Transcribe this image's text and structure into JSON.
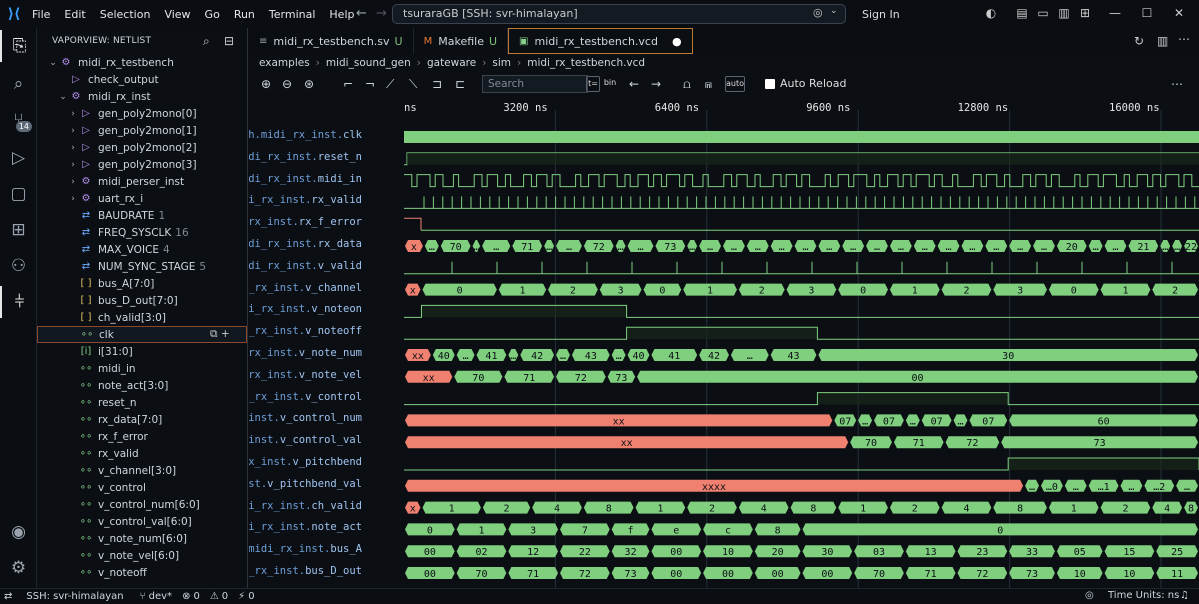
{
  "menu": [
    "File",
    "Edit",
    "Selection",
    "View",
    "Go",
    "Run",
    "Terminal",
    "Help"
  ],
  "command_center": "tsuraraGB [SSH: svr-himalayan]",
  "sign_in": "Sign In",
  "sidebar": {
    "title": "VAPORVIEW: NETLIST",
    "items": [
      {
        "twisty": "v",
        "icon": "module",
        "label": "midi_rx_testbench",
        "value": "",
        "depth": 0
      },
      {
        "twisty": "",
        "icon": "process",
        "label": "check_output",
        "value": "",
        "depth": 1
      },
      {
        "twisty": "v",
        "icon": "module",
        "label": "midi_rx_inst",
        "value": "",
        "depth": 1
      },
      {
        "twisty": ">",
        "icon": "process",
        "label": "gen_poly2mono[0]",
        "value": "",
        "depth": 2
      },
      {
        "twisty": ">",
        "icon": "process",
        "label": "gen_poly2mono[1]",
        "value": "",
        "depth": 2
      },
      {
        "twisty": ">",
        "icon": "process",
        "label": "gen_poly2mono[2]",
        "value": "",
        "depth": 2
      },
      {
        "twisty": ">",
        "icon": "process",
        "label": "gen_poly2mono[3]",
        "value": "",
        "depth": 2
      },
      {
        "twisty": ">",
        "icon": "module",
        "label": "midi_perser_inst",
        "value": "",
        "depth": 2
      },
      {
        "twisty": ">",
        "icon": "module",
        "label": "uart_rx_i",
        "value": "",
        "depth": 2
      },
      {
        "twisty": "",
        "icon": "param",
        "label": "BAUDRATE",
        "value": "1",
        "depth": 2
      },
      {
        "twisty": "",
        "icon": "param",
        "label": "FREQ_SYSCLK",
        "value": "16",
        "depth": 2
      },
      {
        "twisty": "",
        "icon": "param",
        "label": "MAX_VOICE",
        "value": "4",
        "depth": 2
      },
      {
        "twisty": "",
        "icon": "param",
        "label": "NUM_SYNC_STAGE",
        "value": "5",
        "depth": 2
      },
      {
        "twisty": "",
        "icon": "bus",
        "label": "bus_A[7:0]",
        "value": "",
        "depth": 2
      },
      {
        "twisty": "",
        "icon": "bus",
        "label": "bus_D_out[7:0]",
        "value": "",
        "depth": 2
      },
      {
        "twisty": "",
        "icon": "bus",
        "label": "ch_valid[3:0]",
        "value": "",
        "depth": 2
      },
      {
        "twisty": "",
        "icon": "signal",
        "label": "clk",
        "value": "",
        "depth": 2,
        "selected": true
      },
      {
        "twisty": "",
        "icon": "int",
        "label": "i[31:0]",
        "value": "",
        "depth": 2
      },
      {
        "twisty": "",
        "icon": "signal",
        "label": "midi_in",
        "value": "",
        "depth": 2
      },
      {
        "twisty": "",
        "icon": "signal",
        "label": "note_act[3:0]",
        "value": "",
        "depth": 2
      },
      {
        "twisty": "",
        "icon": "signal",
        "label": "reset_n",
        "value": "",
        "depth": 2
      },
      {
        "twisty": "",
        "icon": "signal",
        "label": "rx_data[7:0]",
        "value": "",
        "depth": 2
      },
      {
        "twisty": "",
        "icon": "signal",
        "label": "rx_f_error",
        "value": "",
        "depth": 2
      },
      {
        "twisty": "",
        "icon": "signal",
        "label": "rx_valid",
        "value": "",
        "depth": 2
      },
      {
        "twisty": "",
        "icon": "signal",
        "label": "v_channel[3:0]",
        "value": "",
        "depth": 2
      },
      {
        "twisty": "",
        "icon": "signal",
        "label": "v_control",
        "value": "",
        "depth": 2
      },
      {
        "twisty": "",
        "icon": "signal",
        "label": "v_control_num[6:0]",
        "value": "",
        "depth": 2
      },
      {
        "twisty": "",
        "icon": "signal",
        "label": "v_control_val[6:0]",
        "value": "",
        "depth": 2
      },
      {
        "twisty": "",
        "icon": "signal",
        "label": "v_note_num[6:0]",
        "value": "",
        "depth": 2
      },
      {
        "twisty": "",
        "icon": "signal",
        "label": "v_note_vel[6:0]",
        "value": "",
        "depth": 2
      },
      {
        "twisty": "",
        "icon": "signal",
        "label": "v_noteoff",
        "value": "",
        "depth": 2
      }
    ]
  },
  "tabs": [
    {
      "label": "midi_rx_testbench.sv",
      "status": "U",
      "icon": "≡",
      "icon_color": "#9aa3ad",
      "active": false
    },
    {
      "label": "Makefile",
      "status": "U",
      "icon": "M",
      "icon_color": "#e37933",
      "active": false
    },
    {
      "label": "midi_rx_testbench.vcd",
      "status": "●",
      "icon": "▣",
      "icon_color": "#86d08a",
      "active": true
    }
  ],
  "breadcrumb": [
    "examples",
    "midi_sound_gen",
    "gateware",
    "sim",
    "midi_rx_testbench.vcd"
  ],
  "toolbar": {
    "search_placeholder": "Search",
    "regex_label": "t=",
    "bin_label": "bin",
    "auto_label": "auto",
    "auto_reload_label": "Auto Reload"
  },
  "time_axis": [
    {
      "label": "ns",
      "t": 0
    },
    {
      "label": "3200 ns",
      "t": 3200
    },
    {
      "label": "6400 ns",
      "t": 6400
    },
    {
      "label": "9600 ns",
      "t": 9600
    },
    {
      "label": "12800 ns",
      "t": 12800
    },
    {
      "label": "16000 ns",
      "t": 16000
    }
  ],
  "signals": [
    {
      "prefix": "ch.midi_rx_inst.",
      "leaf": "clk",
      "kind": "clk"
    },
    {
      "prefix": "idi_rx_inst.",
      "leaf": "reset_n",
      "kind": "bit",
      "trans": [
        [
          0,
          0
        ],
        [
          0.005,
          1
        ]
      ]
    },
    {
      "prefix": "idi_rx_inst.",
      "leaf": "midi_in",
      "kind": "serial"
    },
    {
      "prefix": "di_rx_inst.",
      "leaf": "rx_valid",
      "kind": "pulses"
    },
    {
      "prefix": "_rx_inst.",
      "leaf": "rx_f_error",
      "kind": "xbit"
    },
    {
      "prefix": "idi_rx_inst.",
      "leaf": "rx_data",
      "kind": "bus",
      "segs": [
        [
          0,
          0.025,
          "x",
          "",
          1
        ],
        [
          0.025,
          0.045,
          "…"
        ],
        [
          0.045,
          0.085,
          "70"
        ],
        [
          0.085,
          0.097,
          "…"
        ],
        [
          0.097,
          0.135,
          "…"
        ],
        [
          0.135,
          0.175,
          "71"
        ],
        [
          0.175,
          0.19,
          "…"
        ],
        [
          0.19,
          0.225,
          "…"
        ],
        [
          0.225,
          0.265,
          "72"
        ],
        [
          0.265,
          0.28,
          "…"
        ],
        [
          0.28,
          0.315,
          "…"
        ],
        [
          0.315,
          0.355,
          "73"
        ],
        [
          0.355,
          0.37,
          "…"
        ],
        [
          0.37,
          0.4,
          "…"
        ],
        [
          0.4,
          0.43,
          "…"
        ],
        [
          0.43,
          0.46,
          "…"
        ],
        [
          0.46,
          0.49,
          "…"
        ],
        [
          0.49,
          0.52,
          "…"
        ],
        [
          0.52,
          0.55,
          "…"
        ],
        [
          0.55,
          0.58,
          "…"
        ],
        [
          0.58,
          0.61,
          "…"
        ],
        [
          0.61,
          0.64,
          "…"
        ],
        [
          0.64,
          0.67,
          "…"
        ],
        [
          0.67,
          0.7,
          "…"
        ],
        [
          0.7,
          0.73,
          "…"
        ],
        [
          0.73,
          0.76,
          "…"
        ],
        [
          0.76,
          0.79,
          "…"
        ],
        [
          0.79,
          0.82,
          "…"
        ],
        [
          0.82,
          0.86,
          "20"
        ],
        [
          0.86,
          0.88,
          "…"
        ],
        [
          0.88,
          0.91,
          "…"
        ],
        [
          0.91,
          0.95,
          "21"
        ],
        [
          0.95,
          0.965,
          "…"
        ],
        [
          0.965,
          0.98,
          "…"
        ],
        [
          0.98,
          1.0,
          "22"
        ]
      ]
    },
    {
      "prefix": "idi_rx_inst.",
      "leaf": "v_valid",
      "kind": "pulses2"
    },
    {
      "prefix": "i_rx_inst.",
      "leaf": "v_channel",
      "kind": "bus",
      "segs": [
        [
          0,
          0.022,
          "x",
          "",
          1
        ],
        [
          0.022,
          0.118,
          "0"
        ],
        [
          0.118,
          0.18,
          "1"
        ],
        [
          0.18,
          0.245,
          "2"
        ],
        [
          0.245,
          0.3,
          "3"
        ],
        [
          0.3,
          0.35,
          "0"
        ],
        [
          0.35,
          0.42,
          "1"
        ],
        [
          0.42,
          0.48,
          "2"
        ],
        [
          0.48,
          0.545,
          "3"
        ],
        [
          0.545,
          0.61,
          "0"
        ],
        [
          0.61,
          0.675,
          "1"
        ],
        [
          0.675,
          0.74,
          "2"
        ],
        [
          0.74,
          0.81,
          "3"
        ],
        [
          0.81,
          0.875,
          "0"
        ],
        [
          0.875,
          0.94,
          "1"
        ],
        [
          0.94,
          1.0,
          "2"
        ]
      ]
    },
    {
      "prefix": "di_rx_inst.",
      "leaf": "v_noteon",
      "kind": "window",
      "ranges": [
        [
          0.022,
          0.28
        ]
      ]
    },
    {
      "prefix": "i_rx_inst.",
      "leaf": "v_noteoff",
      "kind": "window",
      "ranges": [
        [
          0.28,
          0.52
        ]
      ]
    },
    {
      "prefix": "_rx_inst.",
      "leaf": "v_note_num",
      "kind": "bus",
      "segs": [
        [
          0,
          0.035,
          "xx",
          "",
          1
        ],
        [
          0.035,
          0.065,
          "40"
        ],
        [
          0.065,
          0.09,
          "…"
        ],
        [
          0.09,
          0.13,
          "41"
        ],
        [
          0.13,
          0.145,
          "…"
        ],
        [
          0.145,
          0.19,
          "42"
        ],
        [
          0.19,
          0.21,
          "…"
        ],
        [
          0.21,
          0.26,
          "43"
        ],
        [
          0.26,
          0.28,
          "…"
        ],
        [
          0.28,
          0.31,
          "40"
        ],
        [
          0.31,
          0.37,
          "41"
        ],
        [
          0.37,
          0.41,
          "42"
        ],
        [
          0.41,
          0.46,
          "…"
        ],
        [
          0.46,
          0.52,
          "43"
        ],
        [
          0.52,
          1.0,
          "30"
        ]
      ]
    },
    {
      "prefix": "_rx_inst.",
      "leaf": "v_note_vel",
      "kind": "bus",
      "segs": [
        [
          0,
          0.062,
          "xx",
          "",
          1
        ],
        [
          0.062,
          0.125,
          "70"
        ],
        [
          0.125,
          0.19,
          "71"
        ],
        [
          0.19,
          0.255,
          "72"
        ],
        [
          0.255,
          0.292,
          "73"
        ],
        [
          0.292,
          1.0,
          "00"
        ]
      ]
    },
    {
      "prefix": "i_rx_inst.",
      "leaf": "v_control",
      "kind": "window",
      "ranges": [
        [
          0.52,
          0.76
        ]
      ]
    },
    {
      "prefix": "_inst.",
      "leaf": "v_control_num",
      "kind": "bus",
      "segs": [
        [
          0,
          0.54,
          "xx",
          "",
          1
        ],
        [
          0.54,
          0.57,
          "07"
        ],
        [
          0.57,
          0.59,
          "…"
        ],
        [
          0.59,
          0.63,
          "07"
        ],
        [
          0.63,
          0.65,
          "…"
        ],
        [
          0.65,
          0.69,
          "07"
        ],
        [
          0.69,
          0.71,
          "…"
        ],
        [
          0.71,
          0.76,
          "07"
        ],
        [
          0.76,
          1.0,
          "60"
        ]
      ]
    },
    {
      "prefix": "_inst.",
      "leaf": "v_control_val",
      "kind": "bus",
      "segs": [
        [
          0,
          0.56,
          "xx",
          "",
          1
        ],
        [
          0.56,
          0.615,
          "70"
        ],
        [
          0.615,
          0.68,
          "71"
        ],
        [
          0.68,
          0.75,
          "72"
        ],
        [
          0.75,
          1.0,
          "73"
        ]
      ]
    },
    {
      "prefix": "rx_inst.",
      "leaf": "v_pitchbend",
      "kind": "window",
      "ranges": [
        [
          0.76,
          1.0
        ]
      ]
    },
    {
      "prefix": "nst.",
      "leaf": "v_pitchbend_val",
      "kind": "bus",
      "segs": [
        [
          0,
          0.78,
          "xxxx",
          "",
          1
        ],
        [
          0.78,
          0.8,
          "…"
        ],
        [
          0.8,
          0.83,
          "…0"
        ],
        [
          0.83,
          0.86,
          "…"
        ],
        [
          0.86,
          0.9,
          "…1"
        ],
        [
          0.9,
          0.93,
          "…"
        ],
        [
          0.93,
          0.97,
          "…2"
        ],
        [
          0.97,
          1.0,
          "…"
        ]
      ]
    },
    {
      "prefix": "di_rx_inst.",
      "leaf": "ch_valid",
      "kind": "bus",
      "segs": [
        [
          0,
          0.022,
          "x",
          "",
          1
        ],
        [
          0.022,
          0.098,
          "1"
        ],
        [
          0.098,
          0.16,
          "2"
        ],
        [
          0.16,
          0.225,
          "4"
        ],
        [
          0.225,
          0.29,
          "8"
        ],
        [
          0.29,
          0.355,
          "1"
        ],
        [
          0.355,
          0.42,
          "2"
        ],
        [
          0.42,
          0.485,
          "4"
        ],
        [
          0.485,
          0.545,
          "8"
        ],
        [
          0.545,
          0.61,
          "1"
        ],
        [
          0.61,
          0.675,
          "2"
        ],
        [
          0.675,
          0.74,
          "4"
        ],
        [
          0.74,
          0.81,
          "8"
        ],
        [
          0.81,
          0.875,
          "1"
        ],
        [
          0.875,
          0.94,
          "2"
        ],
        [
          0.94,
          0.98,
          "4"
        ],
        [
          0.98,
          1.0,
          "8"
        ]
      ]
    },
    {
      "prefix": "di_rx_inst.",
      "leaf": "note_act",
      "kind": "bus",
      "segs": [
        [
          0,
          0.065,
          "0"
        ],
        [
          0.065,
          0.13,
          "1"
        ],
        [
          0.13,
          0.195,
          "3"
        ],
        [
          0.195,
          0.26,
          "7"
        ],
        [
          0.26,
          0.31,
          "f"
        ],
        [
          0.31,
          0.375,
          "e"
        ],
        [
          0.375,
          0.44,
          "c"
        ],
        [
          0.44,
          0.5,
          "8"
        ],
        [
          0.5,
          1.0,
          "0"
        ]
      ]
    },
    {
      "prefix": ".midi_rx_inst.",
      "leaf": "bus_A",
      "kind": "bus",
      "segs": [
        [
          0,
          0.065,
          "00"
        ],
        [
          0.065,
          0.13,
          "02"
        ],
        [
          0.13,
          0.195,
          "12"
        ],
        [
          0.195,
          0.26,
          "22"
        ],
        [
          0.26,
          0.31,
          "32"
        ],
        [
          0.31,
          0.375,
          "00"
        ],
        [
          0.375,
          0.44,
          "10"
        ],
        [
          0.44,
          0.5,
          "20"
        ],
        [
          0.5,
          0.565,
          "30"
        ],
        [
          0.565,
          0.63,
          "03"
        ],
        [
          0.63,
          0.695,
          "13"
        ],
        [
          0.695,
          0.76,
          "23"
        ],
        [
          0.76,
          0.82,
          "33"
        ],
        [
          0.82,
          0.88,
          "05"
        ],
        [
          0.88,
          0.945,
          "15"
        ],
        [
          0.945,
          1.0,
          "25"
        ]
      ]
    },
    {
      "prefix": "i_rx_inst.",
      "leaf": "bus_D_out",
      "kind": "bus",
      "segs": [
        [
          0,
          0.065,
          "00"
        ],
        [
          0.065,
          0.13,
          "70"
        ],
        [
          0.13,
          0.195,
          "71"
        ],
        [
          0.195,
          0.26,
          "72"
        ],
        [
          0.26,
          0.31,
          "73"
        ],
        [
          0.31,
          0.375,
          "00"
        ],
        [
          0.375,
          0.44,
          "00"
        ],
        [
          0.44,
          0.5,
          "00"
        ],
        [
          0.5,
          0.565,
          "00"
        ],
        [
          0.565,
          0.63,
          "70"
        ],
        [
          0.63,
          0.695,
          "71"
        ],
        [
          0.695,
          0.76,
          "72"
        ],
        [
          0.76,
          0.82,
          "73"
        ],
        [
          0.82,
          0.88,
          "10"
        ],
        [
          0.88,
          0.945,
          "10"
        ],
        [
          0.945,
          1.0,
          "11"
        ]
      ]
    }
  ],
  "status": {
    "remote": "SSH: svr-himalayan",
    "branch": "dev*",
    "errors": "0",
    "warnings": "0",
    "ports": "0",
    "time_units": "Time Units: ns"
  },
  "colors": {
    "wave_green": "#7fcf7f",
    "wave_x": "#f08070",
    "name_blue": "#6f9fd8",
    "accent_orange": "#c07a30"
  }
}
